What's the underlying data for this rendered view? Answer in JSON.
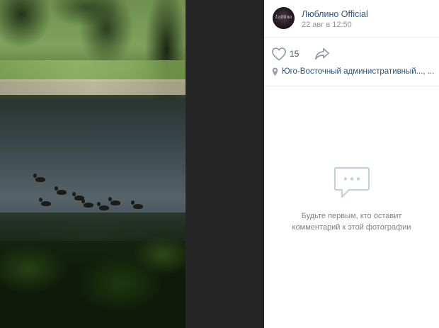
{
  "post": {
    "author": "Люблино Official",
    "avatar_logo": "Lublino",
    "date": "22 авг в 12:50",
    "likes": "15",
    "location": "Юго-Восточный административный..., ..."
  },
  "comments": {
    "empty_line1": "Будьте первым, кто оставит",
    "empty_line2": "комментарий к этой фотографии"
  },
  "icons": {
    "like": "heart-icon",
    "share": "share-arrow-icon",
    "location": "location-pin-icon",
    "comments": "speech-bubble-icon"
  },
  "colors": {
    "link": "#2a5885",
    "muted": "#939393",
    "dark_gap": "#262626"
  }
}
